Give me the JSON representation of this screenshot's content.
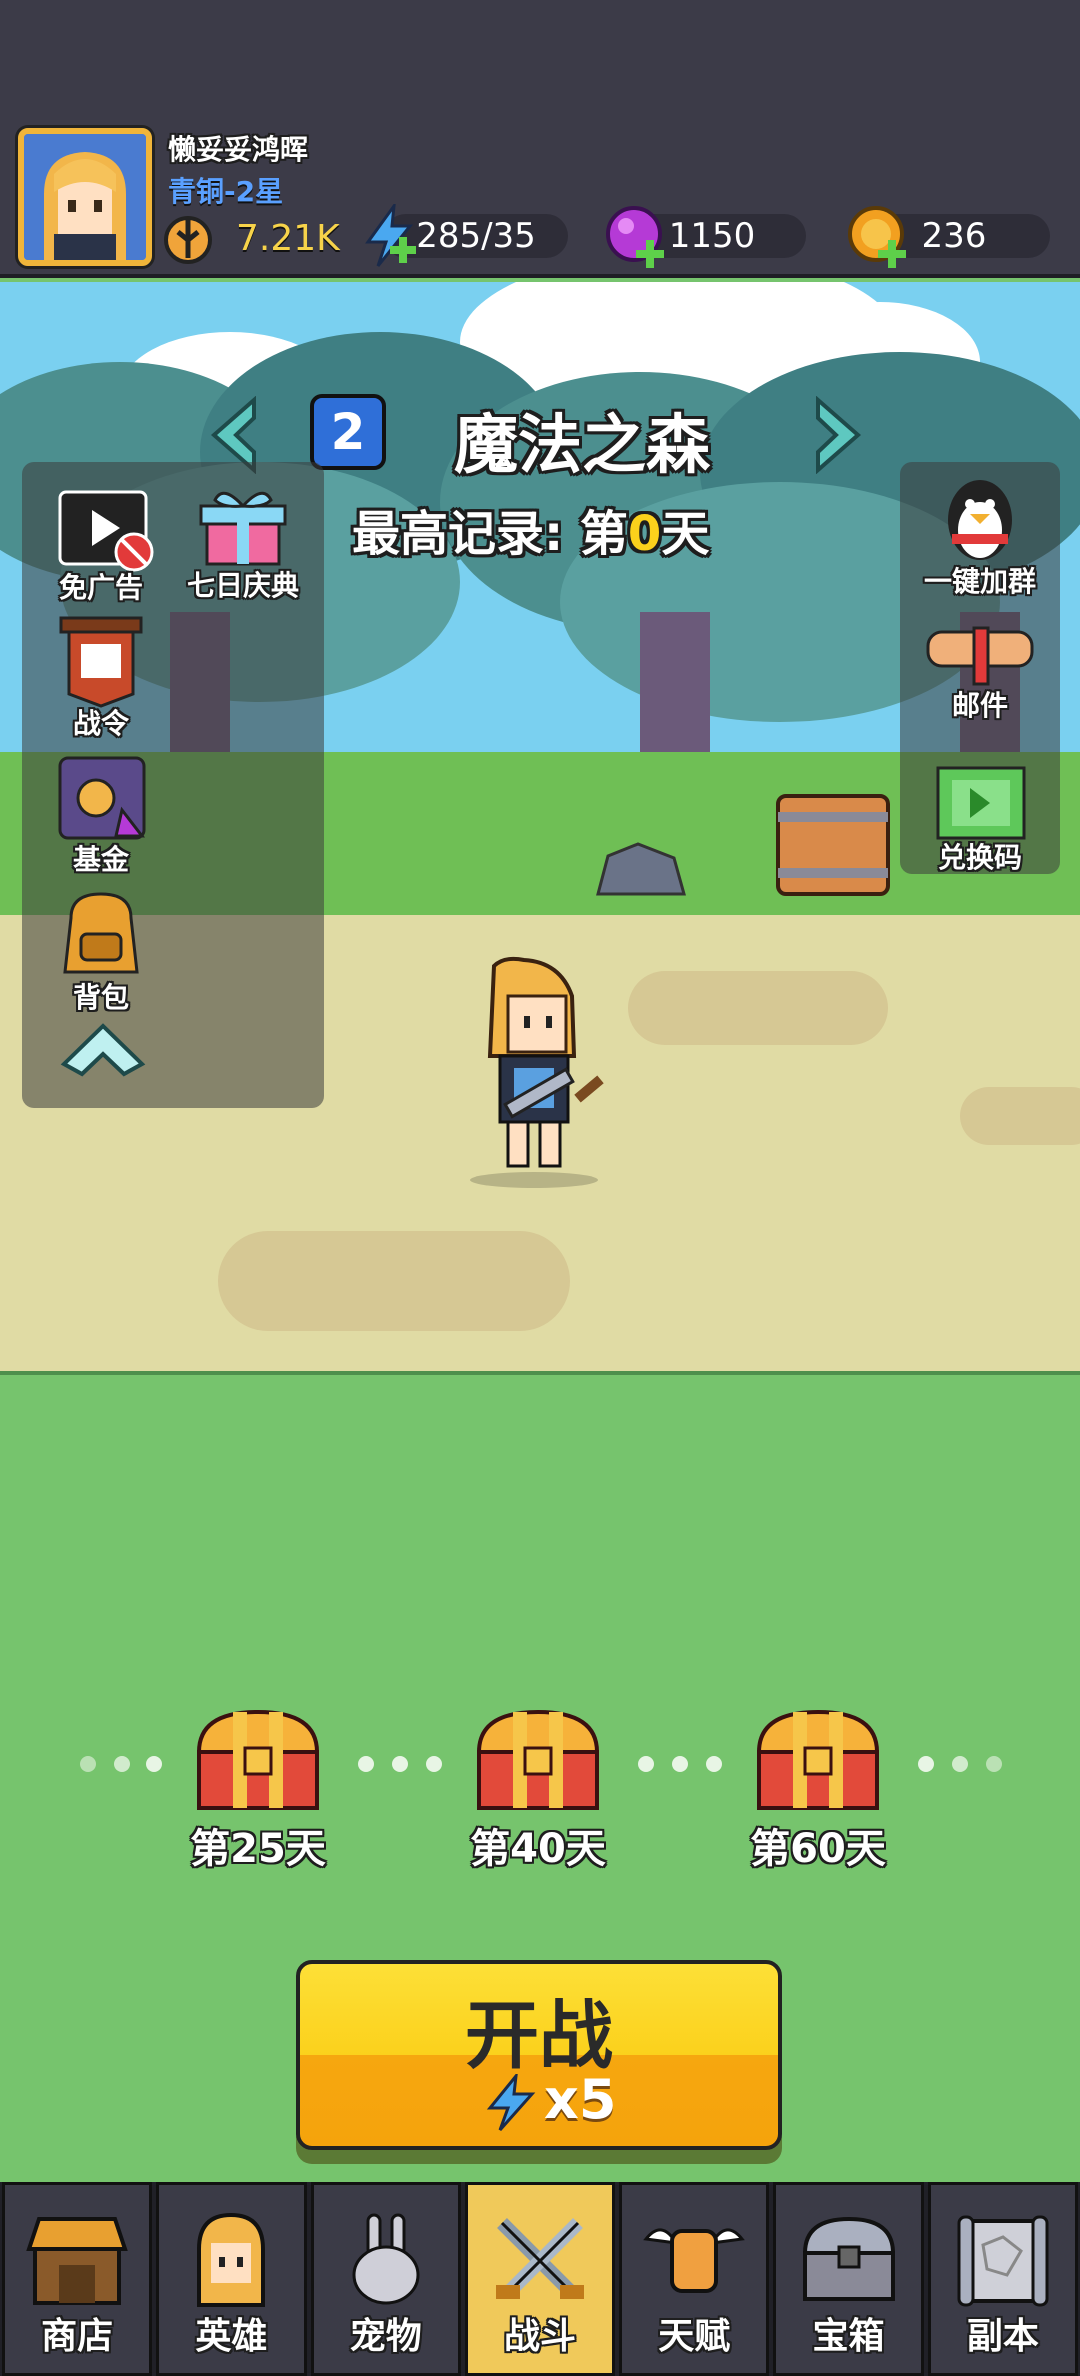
{
  "player": {
    "name": "懒妥妥鸿晖",
    "rank": "青铜-2星",
    "power": "7.21K"
  },
  "resources": {
    "energy": "285/35",
    "gems": "1150",
    "coins": "236"
  },
  "stage": {
    "number": "2",
    "name": "魔法之森",
    "record_prefix": "最高记录: 第",
    "record_value": "0",
    "record_suffix": "天"
  },
  "left_menu": {
    "no_ads": "免广告",
    "seven_day": "七日庆典",
    "battle_pass": "战令",
    "fund": "基金",
    "backpack": "背包"
  },
  "right_menu": {
    "join_group": "一键加群",
    "mail": "邮件",
    "redeem": "兑换码"
  },
  "chests": [
    {
      "label": "第25天"
    },
    {
      "label": "第40天"
    },
    {
      "label": "第60天"
    }
  ],
  "start": {
    "label": "开战",
    "cost": "x5"
  },
  "nav": [
    {
      "label": "商店",
      "icon": "shop-icon"
    },
    {
      "label": "英雄",
      "icon": "hero-icon"
    },
    {
      "label": "宠物",
      "icon": "pet-icon"
    },
    {
      "label": "战斗",
      "icon": "battle-icon",
      "active": true
    },
    {
      "label": "天赋",
      "icon": "talent-icon"
    },
    {
      "label": "宝箱",
      "icon": "chest-icon"
    },
    {
      "label": "副本",
      "icon": "dungeon-icon"
    }
  ],
  "colors": {
    "accent_yellow": "#fbd11c",
    "rank_blue": "#5aa0ff",
    "gem_purple": "#b53ad6",
    "coin_orange": "#f2a020",
    "energy_blue": "#4aa8f0"
  }
}
